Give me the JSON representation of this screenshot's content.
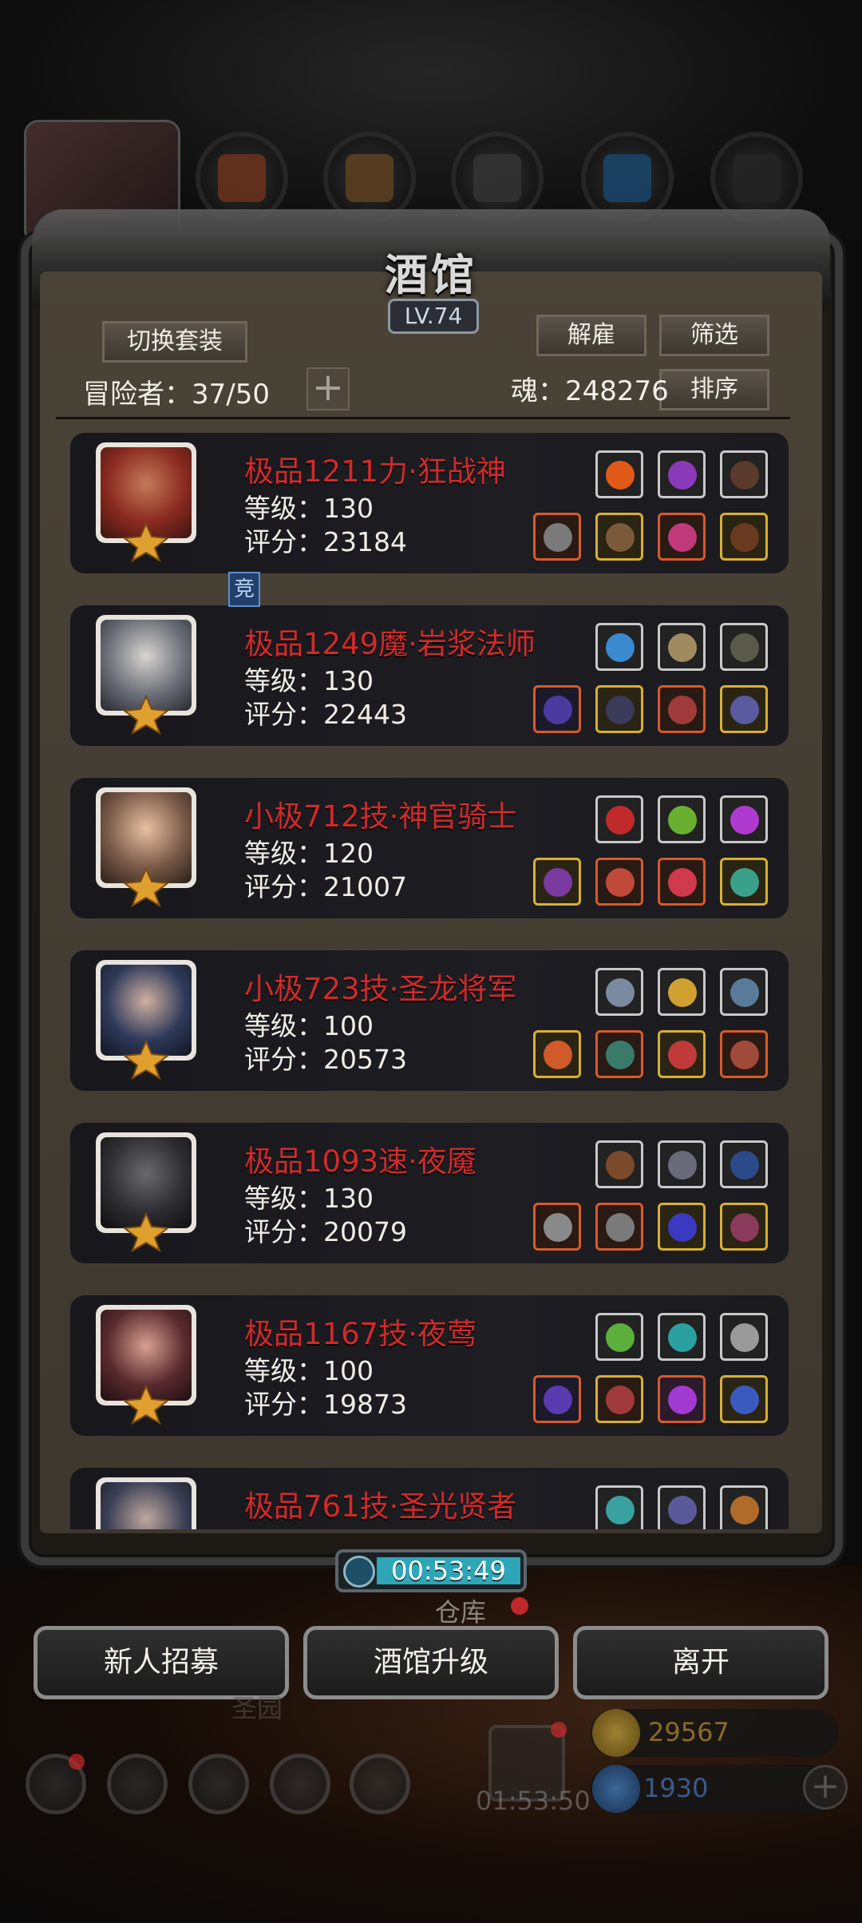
{
  "title": "酒馆",
  "level_badge": "LV.74",
  "buttons": {
    "switch_set": "切换套装",
    "dismiss": "解雇",
    "filter": "筛选",
    "sort": "排序",
    "add": "+",
    "recruit": "新人招募",
    "upgrade": "酒馆升级",
    "leave": "离开"
  },
  "stats": {
    "adventurers": "冒险者：37/50",
    "soul": "魂：248276"
  },
  "competition_tag": "竞",
  "heroes": [
    {
      "name": "极品1211力·狂战神",
      "level": "等级：130",
      "score": "评分：23184",
      "face": "#8a2a20"
    },
    {
      "name": "极品1249魔·岩浆法师",
      "level": "等级：130",
      "score": "评分：22443",
      "face": "#6b6f78"
    },
    {
      "name": "小极712技·神官骑士",
      "level": "等级：120",
      "score": "评分：21007",
      "face": "#7a5a48"
    },
    {
      "name": "小极723技·圣龙将军",
      "level": "等级：100",
      "score": "评分：20573",
      "face": "#2f3a5a"
    },
    {
      "name": "极品1093速·夜魇",
      "level": "等级：130",
      "score": "评分：20079",
      "face": "#2e2e32"
    },
    {
      "name": "极品1167技·夜莺",
      "level": "等级：100",
      "score": "评分：19873",
      "face": "#5a2a2e"
    },
    {
      "name": "极品761技·圣光贤者",
      "level": "",
      "score": "",
      "face": "#3a3f55"
    }
  ],
  "timer": "00:53:49",
  "warehouse_label": "仓库",
  "background_label": "圣园",
  "gift_timer": "01:53:50",
  "currency": {
    "gold": "29567",
    "gems": "1930"
  },
  "colors": {
    "hero_name_red": "#d12a2a",
    "timer_cyan": "#2fa6b7",
    "panel_brown": "#4a4337"
  }
}
